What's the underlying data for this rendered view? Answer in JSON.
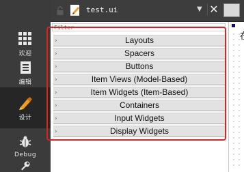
{
  "modebar": {
    "items": [
      {
        "label": "欢迎",
        "icon": "welcome-grid-icon"
      },
      {
        "label": "编辑",
        "icon": "edit-document-icon"
      },
      {
        "label": "设计",
        "icon": "design-pencil-icon",
        "active": true
      },
      {
        "label": "Debug",
        "icon": "debug-bug-icon"
      },
      {
        "label": "",
        "icon": "wrench-icon"
      }
    ]
  },
  "editor_tab": {
    "filename": "test.ui",
    "dropdown_icon": "chevron-down-icon",
    "close_icon": "close-icon"
  },
  "widget_box": {
    "filter_placeholder": "Filter",
    "categories": [
      {
        "label": "Layouts"
      },
      {
        "label": "Spacers"
      },
      {
        "label": "Buttons"
      },
      {
        "label": "Item Views (Model-Based)"
      },
      {
        "label": "Item Widgets (Item-Based)"
      },
      {
        "label": "Containers"
      },
      {
        "label": "Input Widgets"
      },
      {
        "label": "Display Widgets"
      }
    ]
  },
  "canvas": {
    "visible_text": "在"
  },
  "colors": {
    "modebar_bg": "#3b3b3b",
    "modebar_active_bg": "#262626",
    "highlight": "#e02020",
    "category_bg": "#e2e2e2"
  }
}
